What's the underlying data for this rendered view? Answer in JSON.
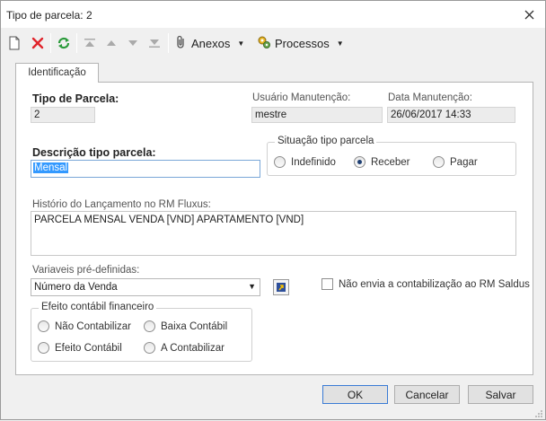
{
  "window": {
    "title": "Tipo de parcela: 2"
  },
  "toolbar": {
    "anexos_label": "Anexos",
    "processos_label": "Processos",
    "icons": [
      "new-doc-icon",
      "delete-icon",
      "refresh-icon",
      "first-icon",
      "previous-icon",
      "next-icon",
      "last-icon",
      "paperclip-icon",
      "processes-icon"
    ]
  },
  "tabs": [
    {
      "label": "Identificação"
    }
  ],
  "form": {
    "tipo_parcela": {
      "label": "Tipo de Parcela:",
      "value": "2"
    },
    "usuario_manutencao": {
      "label": "Usuário Manutenção:",
      "value": "mestre"
    },
    "data_manutencao": {
      "label": "Data Manutenção:",
      "value": "26/06/2017 14:33"
    },
    "descricao": {
      "label": "Descrição tipo parcela:",
      "value": "Mensal"
    },
    "situacao": {
      "title": "Situação tipo parcela",
      "options": [
        "Indefinido",
        "Receber",
        "Pagar"
      ],
      "selected": "Receber"
    },
    "historico": {
      "label": "Histório do Lançamento no RM Fluxus:",
      "value": "PARCELA MENSAL VENDA [VND] APARTAMENTO [VND]"
    },
    "variaveis": {
      "label": "Variaveis pré-definidas:",
      "value": "Número da Venda"
    },
    "nao_envia": {
      "label": "Não envia a contabilização ao RM Saldus",
      "checked": false
    },
    "efeito": {
      "title": "Efeito contábil financeiro",
      "options": [
        "Não Contabilizar",
        "Baixa Contábil",
        "Efeito Contábil",
        "A Contabilizar"
      ],
      "selected": ""
    }
  },
  "buttons": {
    "ok": "OK",
    "cancel": "Cancelar",
    "save": "Salvar"
  },
  "colors": {
    "accent": "#3399ff",
    "delete": "#e0242b",
    "refresh": "#2a9a3a"
  }
}
